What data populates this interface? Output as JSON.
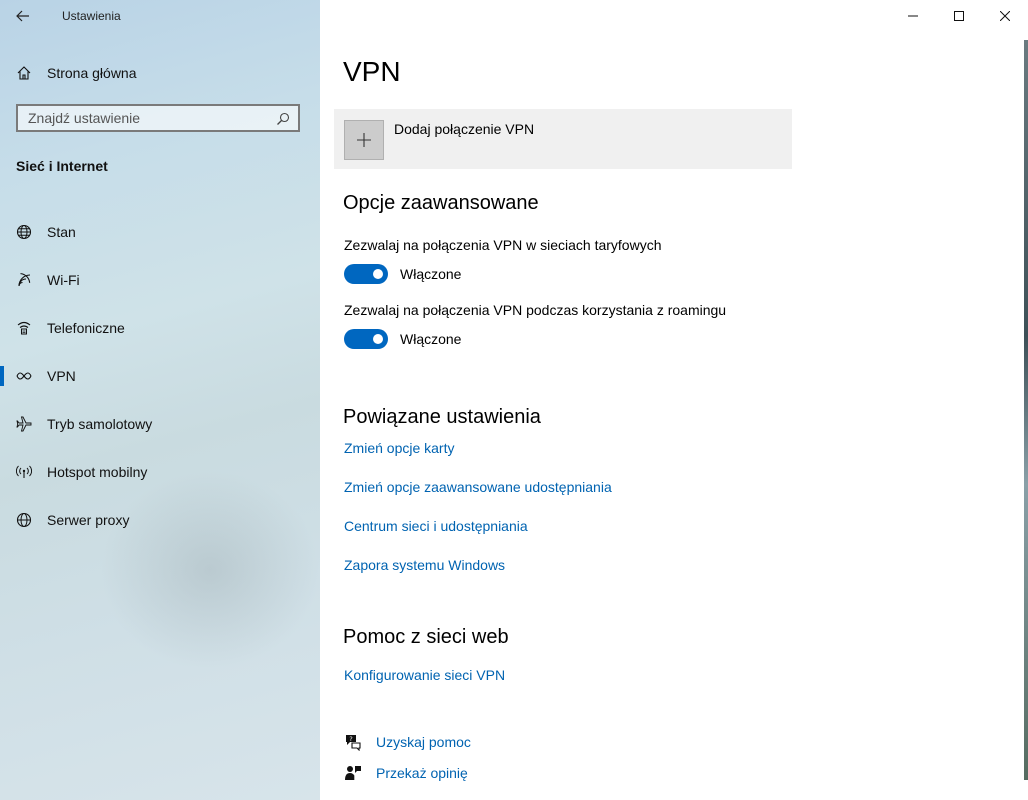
{
  "window": {
    "app_title": "Ustawienia"
  },
  "sidebar": {
    "home_label": "Strona główna",
    "search_placeholder": "Znajdź ustawienie",
    "section_heading": "Sieć i Internet",
    "items": [
      {
        "label": "Stan",
        "icon": "globe-icon"
      },
      {
        "label": "Wi-Fi",
        "icon": "wifi-icon"
      },
      {
        "label": "Telefoniczne",
        "icon": "dialup-icon"
      },
      {
        "label": "VPN",
        "icon": "vpn-icon",
        "selected": true
      },
      {
        "label": "Tryb samolotowy",
        "icon": "airplane-icon"
      },
      {
        "label": "Hotspot mobilny",
        "icon": "hotspot-icon"
      },
      {
        "label": "Serwer proxy",
        "icon": "globe-icon"
      }
    ]
  },
  "main": {
    "title": "VPN",
    "add_vpn_label": "Dodaj połączenie VPN",
    "advanced": {
      "heading": "Opcje zaawansowane",
      "metered_label": "Zezwalaj na połączenia VPN w sieciach taryfowych",
      "metered_state": "Włączone",
      "metered_on": true,
      "roaming_label": "Zezwalaj na połączenia VPN podczas korzystania z roamingu",
      "roaming_state": "Włączone",
      "roaming_on": true
    },
    "related": {
      "heading": "Powiązane ustawienia",
      "links": [
        "Zmień opcje karty",
        "Zmień opcje zaawansowane udostępniania",
        "Centrum sieci i udostępniania",
        "Zapora systemu Windows"
      ]
    },
    "web_help": {
      "heading": "Pomoc z sieci web",
      "link": "Konfigurowanie sieci VPN"
    },
    "footer": {
      "get_help": "Uzyskaj pomoc",
      "feedback": "Przekaż opinię"
    }
  },
  "colors": {
    "accent": "#0067c0",
    "link": "#0063b1"
  }
}
